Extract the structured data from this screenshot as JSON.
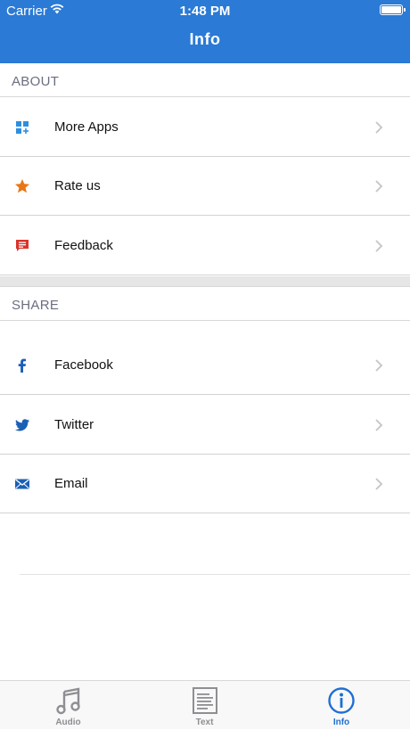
{
  "status_bar": {
    "carrier": "Carrier",
    "time": "1:48 PM"
  },
  "header": {
    "title": "Info"
  },
  "sections": [
    {
      "title": "ABOUT",
      "items": [
        {
          "label": "More Apps",
          "icon": "grid-plus-icon",
          "color": "#2d8fe0"
        },
        {
          "label": "Rate us",
          "icon": "star-icon",
          "color": "#e87716"
        },
        {
          "label": "Feedback",
          "icon": "feedback-icon",
          "color": "#d9342b"
        }
      ]
    },
    {
      "title": "SHARE",
      "items": [
        {
          "label": "Facebook",
          "icon": "facebook-icon",
          "color": "#1b5fb7"
        },
        {
          "label": "Twitter",
          "icon": "twitter-icon",
          "color": "#1b5fb7"
        },
        {
          "label": "Email",
          "icon": "email-icon",
          "color": "#1b5fb7"
        }
      ]
    }
  ],
  "tabbar": {
    "tabs": [
      {
        "label": "Audio",
        "icon": "music-note-icon",
        "active": false
      },
      {
        "label": "Text",
        "icon": "document-icon",
        "active": false
      },
      {
        "label": "Info",
        "icon": "info-icon",
        "active": true
      }
    ],
    "active_color": "#1f6fd1"
  },
  "colors": {
    "header": "#2a7ad6",
    "section_gap": "#e6e6e6"
  }
}
